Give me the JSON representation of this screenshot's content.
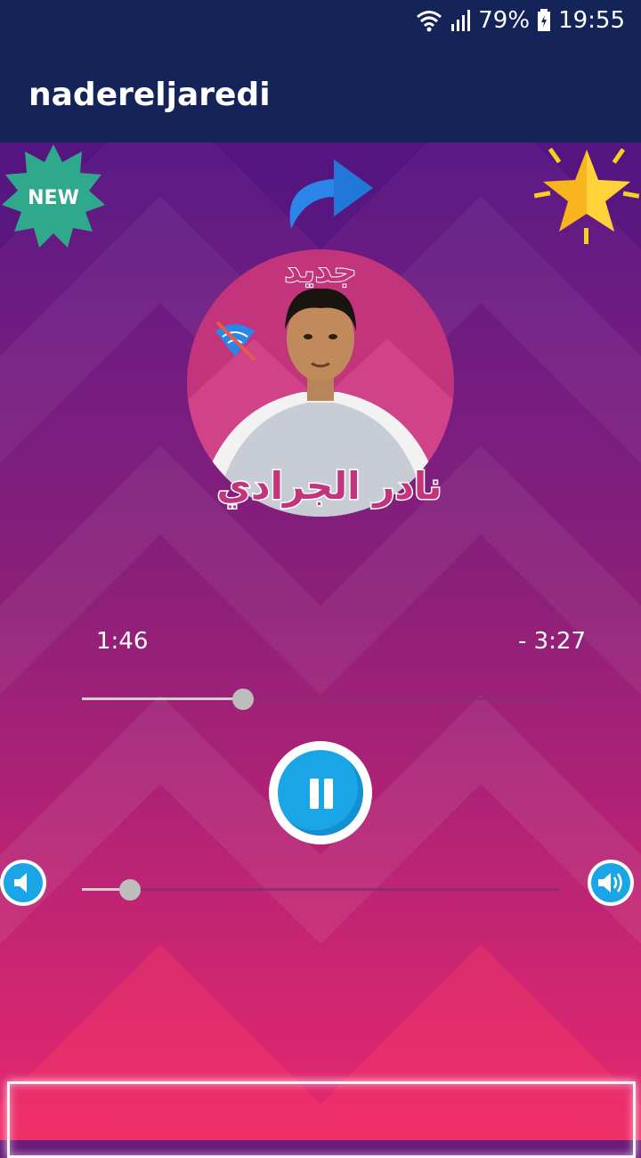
{
  "status_bar": {
    "battery": "79%",
    "time": "19:55",
    "icons": [
      "wifi-icon",
      "signal-icon",
      "battery-icon"
    ]
  },
  "app_bar": {
    "title": "nadereljaredi"
  },
  "header_icons": {
    "new_badge": "NEW",
    "share": "share-icon",
    "rate": "star-icon"
  },
  "album": {
    "top_text": "جديد",
    "bottom_text": "نادر الجرادي",
    "overlay_icon": "wifi-off-icon"
  },
  "player": {
    "elapsed": "1:46",
    "remaining": "- 3:27",
    "progress": 0.338,
    "volume": 0.1,
    "state_icon": "pause-icon"
  },
  "colors": {
    "bar": "#142458",
    "accent": "#1aa6e6",
    "bg_top": "#5b1a86",
    "bg_bottom": "#e8286e"
  }
}
